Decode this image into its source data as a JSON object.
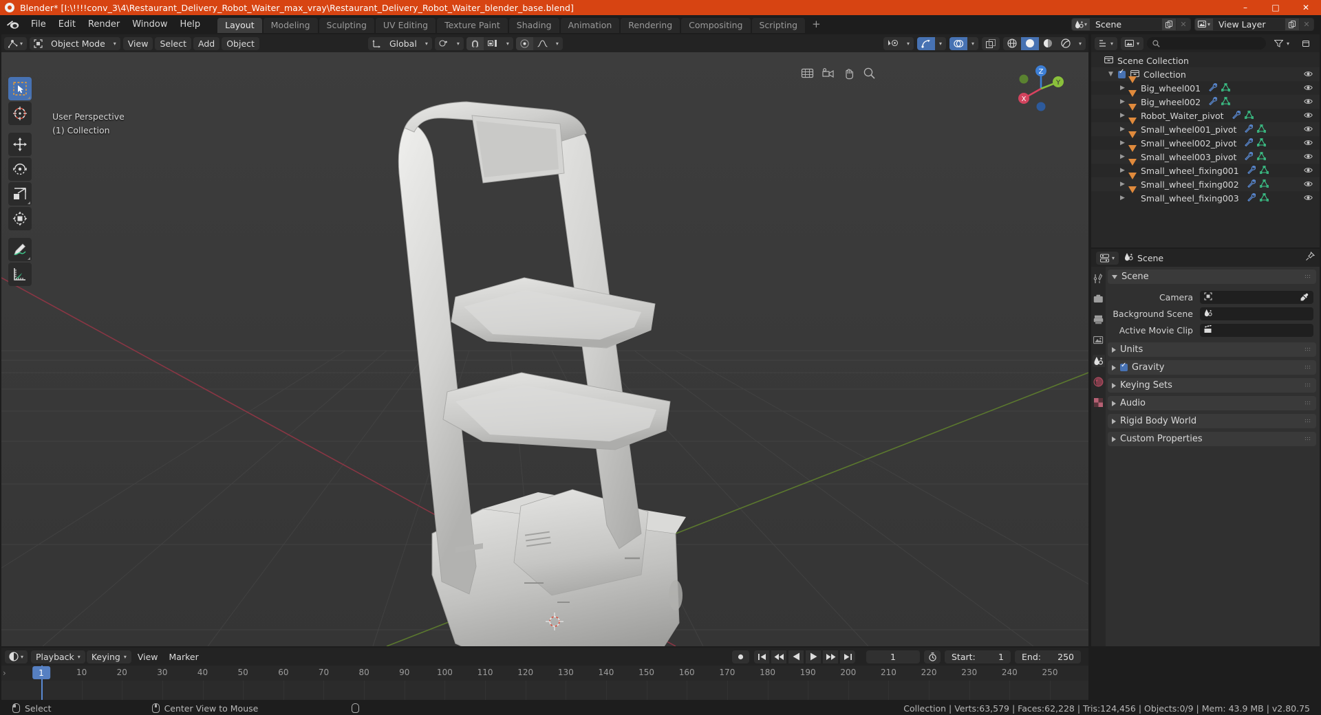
{
  "window": {
    "title": "Blender* [I:\\!!!!conv_3\\4\\Restaurant_Delivery_Robot_Waiter_max_vray\\Restaurant_Delivery_Robot_Waiter_blender_base.blend]",
    "minimize": "–",
    "maximize": "□",
    "close": "✕"
  },
  "topbar": {
    "menus": [
      "File",
      "Edit",
      "Render",
      "Window",
      "Help"
    ],
    "workspaces": [
      {
        "label": "Layout",
        "active": true
      },
      {
        "label": "Modeling",
        "active": false
      },
      {
        "label": "Sculpting",
        "active": false
      },
      {
        "label": "UV Editing",
        "active": false
      },
      {
        "label": "Texture Paint",
        "active": false
      },
      {
        "label": "Shading",
        "active": false
      },
      {
        "label": "Animation",
        "active": false
      },
      {
        "label": "Rendering",
        "active": false
      },
      {
        "label": "Compositing",
        "active": false
      },
      {
        "label": "Scripting",
        "active": false
      }
    ],
    "add_workspace": "+",
    "scene_name": "Scene",
    "view_layer_name": "View Layer",
    "new_icon": "new-datablock-icon",
    "unlink_icon": "unlink-datablock-icon"
  },
  "viewport": {
    "mode": "Object Mode",
    "menus": [
      "View",
      "Select",
      "Add",
      "Object"
    ],
    "transform_orientation": "Global",
    "overlay_text_line1": "User Perspective",
    "overlay_text_line2": "(1) Collection",
    "tools": [
      {
        "name": "tweak-select-tool",
        "active": true
      },
      {
        "name": "cursor-tool",
        "active": false
      },
      {
        "name": "move-tool",
        "active": false
      },
      {
        "name": "rotate-tool",
        "active": false
      },
      {
        "name": "scale-tool",
        "active": false
      },
      {
        "name": "transform-tool",
        "active": false
      },
      {
        "name": "annotate-tool",
        "active": false
      },
      {
        "name": "measure-tool",
        "active": false
      }
    ],
    "gizmo_axes": [
      "X",
      "Y",
      "Z"
    ],
    "shading_modes": [
      "wireframe",
      "solid",
      "material-preview",
      "rendered"
    ],
    "shading_active": "solid"
  },
  "outliner": {
    "display_mode": "view-layer",
    "filter_placeholder": "",
    "rows": [
      {
        "label": "Scene Collection",
        "indent": 0,
        "kind": "scene-collection",
        "expander": "",
        "checkbox": false,
        "modifier": false,
        "mesh": false,
        "eye": false
      },
      {
        "label": "Collection",
        "indent": 1,
        "kind": "collection",
        "expander": "down",
        "checkbox": true,
        "modifier": false,
        "mesh": false,
        "eye": true
      },
      {
        "label": "Big_wheel001",
        "indent": 2,
        "kind": "object",
        "expander": "right",
        "checkbox": false,
        "modifier": true,
        "mesh": true,
        "eye": true
      },
      {
        "label": "Big_wheel002",
        "indent": 2,
        "kind": "object",
        "expander": "right",
        "checkbox": false,
        "modifier": true,
        "mesh": true,
        "eye": true
      },
      {
        "label": "Robot_Waiter_pivot",
        "indent": 2,
        "kind": "object",
        "expander": "right",
        "checkbox": false,
        "modifier": true,
        "mesh": true,
        "eye": true
      },
      {
        "label": "Small_wheel001_pivot",
        "indent": 2,
        "kind": "object",
        "expander": "right",
        "checkbox": false,
        "modifier": true,
        "mesh": true,
        "eye": true
      },
      {
        "label": "Small_wheel002_pivot",
        "indent": 2,
        "kind": "object",
        "expander": "right",
        "checkbox": false,
        "modifier": true,
        "mesh": true,
        "eye": true
      },
      {
        "label": "Small_wheel003_pivot",
        "indent": 2,
        "kind": "object",
        "expander": "right",
        "checkbox": false,
        "modifier": true,
        "mesh": true,
        "eye": true
      },
      {
        "label": "Small_wheel_fixing001",
        "indent": 2,
        "kind": "object",
        "expander": "right",
        "checkbox": false,
        "modifier": true,
        "mesh": true,
        "eye": true
      },
      {
        "label": "Small_wheel_fixing002",
        "indent": 2,
        "kind": "object",
        "expander": "right",
        "checkbox": false,
        "modifier": true,
        "mesh": true,
        "eye": true
      },
      {
        "label": "Small_wheel_fixing003",
        "indent": 2,
        "kind": "object",
        "expander": "right",
        "checkbox": false,
        "modifier": true,
        "mesh": true,
        "eye": true
      }
    ]
  },
  "properties": {
    "breadcrumb": "Scene",
    "panels": [
      {
        "label": "Scene",
        "open": true,
        "checkbox": false
      },
      {
        "label": "Units",
        "open": false,
        "checkbox": false
      },
      {
        "label": "Gravity",
        "open": false,
        "checkbox": true
      },
      {
        "label": "Keying Sets",
        "open": false,
        "checkbox": false
      },
      {
        "label": "Audio",
        "open": false,
        "checkbox": false
      },
      {
        "label": "Rigid Body World",
        "open": false,
        "checkbox": false
      },
      {
        "label": "Custom Properties",
        "open": false,
        "checkbox": false
      }
    ],
    "fields": [
      {
        "label": "Camera",
        "value": "",
        "icon": "camera-icon",
        "eyedropper": true
      },
      {
        "label": "Background Scene",
        "value": "",
        "icon": "scene-icon",
        "eyedropper": false
      },
      {
        "label": "Active Movie Clip",
        "value": "",
        "icon": "clip-icon",
        "eyedropper": false
      }
    ],
    "tabs": [
      {
        "name": "tool-tab",
        "active": false
      },
      {
        "name": "render-tab",
        "active": false
      },
      {
        "name": "output-tab",
        "active": false
      },
      {
        "name": "view-layer-tab",
        "active": false
      },
      {
        "name": "scene-tab",
        "active": true
      },
      {
        "name": "world-tab",
        "active": false
      },
      {
        "name": "texture-tab",
        "active": false
      }
    ]
  },
  "timeline": {
    "menus": [
      "Playback",
      "Keying",
      "View",
      "Marker"
    ],
    "current_frame": "1",
    "start_label": "Start:",
    "start_value": "1",
    "end_label": "End:",
    "end_value": "250",
    "ruler_ticks": [
      "1",
      "10",
      "20",
      "30",
      "40",
      "50",
      "60",
      "70",
      "80",
      "90",
      "100",
      "110",
      "120",
      "130",
      "140",
      "150",
      "160",
      "170",
      "180",
      "190",
      "200",
      "210",
      "220",
      "230",
      "240",
      "250"
    ],
    "playhead_frame": "1"
  },
  "statusbar": {
    "left_select": "Select",
    "center_view": "Center View to Mouse",
    "stats": "Collection | Verts:63,579 | Faces:62,228 | Tris:124,456 | Objects:0/9 | Mem: 43.9 MB | v2.80.75"
  },
  "colors": {
    "accent": "#4772b3",
    "title_bar": "#d74412",
    "object_orange": "#e08a3c",
    "mesh_green": "#3cc98b",
    "modifier_blue": "#5a8ad4",
    "axis_x": "#d9435f",
    "axis_y": "#8ac03b",
    "axis_z": "#3d7fd6"
  }
}
